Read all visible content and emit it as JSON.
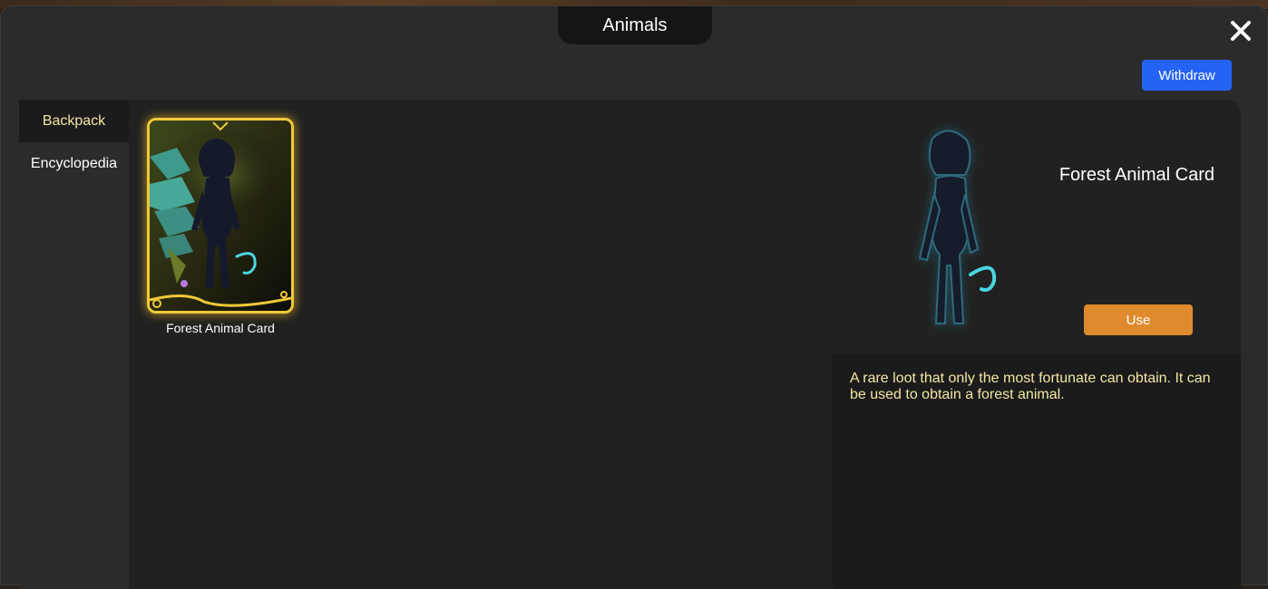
{
  "window": {
    "title": "Animals",
    "close_icon": "close-icon"
  },
  "toolbar": {
    "withdraw_label": "Withdraw"
  },
  "sidebar": {
    "items": [
      {
        "label": "Backpack",
        "active": true
      },
      {
        "label": "Encyclopedia",
        "active": false
      }
    ]
  },
  "inventory": {
    "items": [
      {
        "name": "Forest Animal Card",
        "selected": true
      }
    ]
  },
  "detail": {
    "name": "Forest Animal Card",
    "use_label": "Use",
    "description": "A rare loot that only the most fortunate can obtain. It can be used to obtain a forest animal."
  },
  "colors": {
    "accent_blue": "#2563f5",
    "use_orange": "#e08a2e",
    "highlight_text": "#f3e7a3",
    "card_border_gold": "#f0c93a",
    "silhouette_glow": "#4ad6e0"
  }
}
